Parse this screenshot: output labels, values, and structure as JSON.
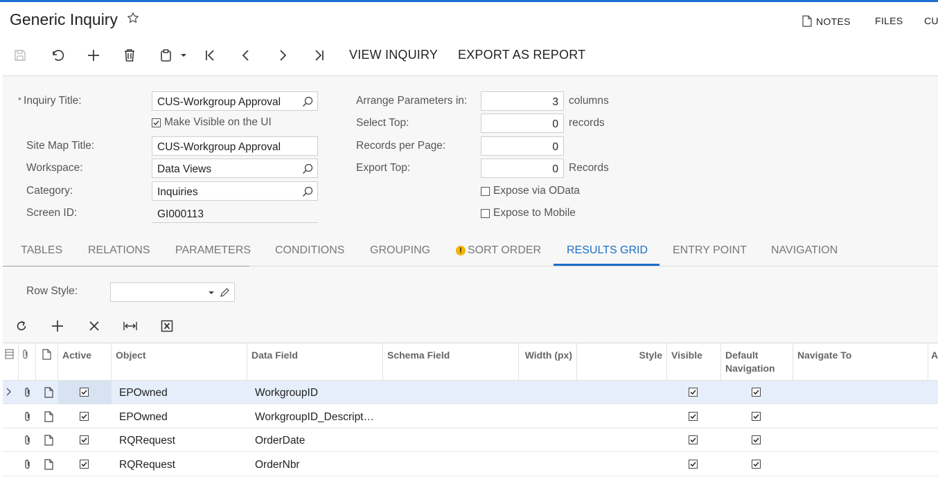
{
  "header": {
    "title": "Generic Inquiry",
    "actions": [
      "NOTES",
      "FILES",
      "CU"
    ]
  },
  "toolbar": {
    "icons": [
      "save-icon",
      "undo-icon",
      "add-icon",
      "delete-icon",
      "clipboard-icon",
      "first-icon",
      "prev-icon",
      "next-icon",
      "last-icon"
    ],
    "view_inquiry": "VIEW INQUIRY",
    "export_as_report": "EXPORT AS REPORT"
  },
  "form": {
    "inquiry_title_label": "Inquiry Title:",
    "inquiry_title_value": "CUS-Workgroup Approval",
    "make_visible_label": "Make Visible on the UI",
    "make_visible_checked": true,
    "site_map_title_label": "Site Map Title:",
    "site_map_title_value": "CUS-Workgroup Approval",
    "workspace_label": "Workspace:",
    "workspace_value": "Data Views",
    "category_label": "Category:",
    "category_value": "Inquiries",
    "screen_id_label": "Screen ID:",
    "screen_id_value": "GI000113",
    "arrange_label": "Arrange Parameters in:",
    "arrange_value": "3",
    "arrange_suffix": "columns",
    "select_top_label": "Select Top:",
    "select_top_value": "0",
    "select_top_suffix": "records",
    "records_per_page_label": "Records per Page:",
    "records_per_page_value": "0",
    "export_top_label": "Export Top:",
    "export_top_value": "0",
    "export_top_suffix": "Records",
    "expose_odata_label": "Expose via OData",
    "expose_mobile_label": "Expose to Mobile"
  },
  "tabs": [
    "TABLES",
    "RELATIONS",
    "PARAMETERS",
    "CONDITIONS",
    "GROUPING",
    "SORT ORDER",
    "RESULTS GRID",
    "ENTRY POINT",
    "NAVIGATION"
  ],
  "active_tab": "RESULTS GRID",
  "results": {
    "row_style_label": "Row Style:",
    "row_style_value": ""
  },
  "grid": {
    "columns": {
      "active": "Active",
      "object": "Object",
      "data_field": "Data Field",
      "schema_field": "Schema Field",
      "width": "Width (px)",
      "style": "Style",
      "visible": "Visible",
      "default_navigation": "Default Navigation",
      "navigate_to": "Navigate To",
      "overflow": "A F"
    },
    "rows": [
      {
        "object": "EPOwned",
        "data_field": "WorkgroupID",
        "active": true,
        "visible": true,
        "default_navigation": true
      },
      {
        "object": "EPOwned",
        "data_field": "WorkgroupID_Descript…",
        "active": true,
        "visible": true,
        "default_navigation": true
      },
      {
        "object": "RQRequest",
        "data_field": "OrderDate",
        "active": true,
        "visible": true,
        "default_navigation": true
      },
      {
        "object": "RQRequest",
        "data_field": "OrderNbr",
        "active": true,
        "visible": true,
        "default_navigation": true
      }
    ]
  },
  "colors": {
    "accent": "#1a6fc9",
    "selected_row": "#e5eefa",
    "warning": "#f5b400"
  }
}
